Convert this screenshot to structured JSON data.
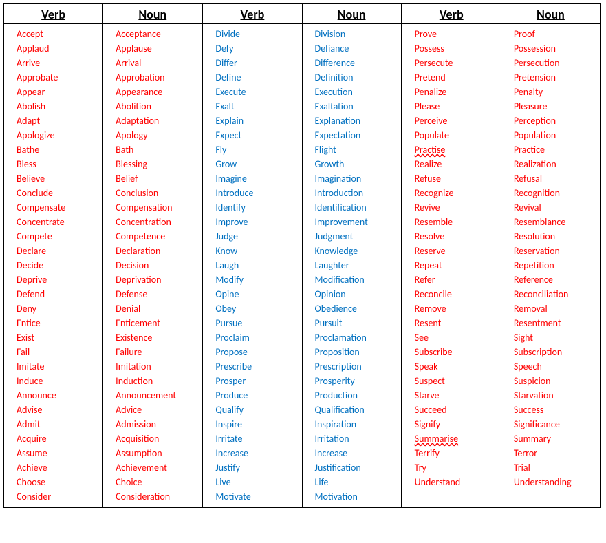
{
  "headers": {
    "verb": "Verb",
    "noun": "Noun"
  },
  "groups": [
    {
      "color": "c-red",
      "rows": [
        {
          "v": "Accept",
          "n": "Acceptance"
        },
        {
          "v": "Applaud",
          "n": "Applause"
        },
        {
          "v": "Arrive",
          "n": "Arrival"
        },
        {
          "v": "Approbate",
          "n": "Approbation"
        },
        {
          "v": "Appear",
          "n": "Appearance"
        },
        {
          "v": "Abolish",
          "n": "Abolition"
        },
        {
          "v": "Adapt",
          "n": "Adaptation"
        },
        {
          "v": "Apologize",
          "n": "Apology"
        },
        {
          "v": "Bathe",
          "n": "Bath"
        },
        {
          "v": "Bless",
          "n": "Blessing"
        },
        {
          "v": "Believe",
          "n": "Belief"
        },
        {
          "v": "Conclude",
          "n": "Conclusion"
        },
        {
          "v": "Compensate",
          "n": "Compensation"
        },
        {
          "v": "Concentrate",
          "n": "Concentration"
        },
        {
          "v": "Compete",
          "n": "Competence"
        },
        {
          "v": "Declare",
          "n": "Declaration"
        },
        {
          "v": "Decide",
          "n": "Decision"
        },
        {
          "v": "Deprive",
          "n": "Deprivation"
        },
        {
          "v": "Defend",
          "n": "Defense"
        },
        {
          "v": "Deny",
          "n": "Denial"
        },
        {
          "v": "Entice",
          "n": "Enticement"
        },
        {
          "v": "Exist",
          "n": "Existence"
        },
        {
          "v": "Fail",
          "n": "Failure"
        },
        {
          "v": "Imitate",
          "n": "Imitation"
        },
        {
          "v": "Induce",
          "n": "Induction"
        },
        {
          "v": "Announce",
          "n": "Announcement"
        },
        {
          "v": "Advise",
          "n": "Advice"
        },
        {
          "v": "Admit",
          "n": "Admission"
        },
        {
          "v": "Acquire",
          "n": "Acquisition"
        },
        {
          "v": "Assume",
          "n": "Assumption"
        },
        {
          "v": "Achieve",
          "n": "Achievement"
        },
        {
          "v": "Choose",
          "n": "Choice"
        },
        {
          "v": "Consider",
          "n": "Consideration"
        }
      ]
    },
    {
      "color": "c-blue",
      "rows": [
        {
          "v": "Divide",
          "n": "Division"
        },
        {
          "v": "Defy",
          "n": "Defiance"
        },
        {
          "v": "Differ",
          "n": "Difference"
        },
        {
          "v": "Define",
          "n": "Definition"
        },
        {
          "v": "Execute",
          "n": "Execution"
        },
        {
          "v": "Exalt",
          "n": "Exaltation"
        },
        {
          "v": "Explain",
          "n": "Explanation"
        },
        {
          "v": "Expect",
          "n": "Expectation"
        },
        {
          "v": "Fly",
          "n": "Flight"
        },
        {
          "v": "Grow",
          "n": "Growth"
        },
        {
          "v": "Imagine",
          "n": "Imagination"
        },
        {
          "v": "Introduce",
          "n": "Introduction"
        },
        {
          "v": "Identify",
          "n": "Identification"
        },
        {
          "v": "Improve",
          "n": "Improvement"
        },
        {
          "v": "Judge",
          "n": "Judgment"
        },
        {
          "v": "Know",
          "n": "Knowledge"
        },
        {
          "v": "Laugh",
          "n": "Laughter"
        },
        {
          "v": "Modify",
          "n": "Modification"
        },
        {
          "v": "Opine",
          "n": "Opinion"
        },
        {
          "v": "Obey",
          "n": "Obedience"
        },
        {
          "v": "Pursue",
          "n": "Pursuit"
        },
        {
          "v": "Proclaim",
          "n": "Proclamation"
        },
        {
          "v": "Propose",
          "n": "Proposition"
        },
        {
          "v": "Prescribe",
          "n": "Prescription"
        },
        {
          "v": "Prosper",
          "n": "Prosperity"
        },
        {
          "v": "Produce",
          "n": "Production"
        },
        {
          "v": "Qualify",
          "n": "Qualification"
        },
        {
          "v": "Inspire",
          "n": "Inspiration"
        },
        {
          "v": "Irritate",
          "n": "Irritation"
        },
        {
          "v": "Increase",
          "n": "Increase"
        },
        {
          "v": "Justify",
          "n": "Justification"
        },
        {
          "v": "Live",
          "n": "Life"
        },
        {
          "v": "Motivate",
          "n": "Motivation"
        }
      ]
    },
    {
      "color": "c-red",
      "rows": [
        {
          "v": "Prove",
          "n": "Proof"
        },
        {
          "v": "Possess",
          "n": "Possession"
        },
        {
          "v": "Persecute",
          "n": "Persecution"
        },
        {
          "v": "Pretend",
          "n": "Pretension"
        },
        {
          "v": "Penalize",
          "n": "Penalty"
        },
        {
          "v": "Please",
          "n": "Pleasure"
        },
        {
          "v": "Perceive",
          "n": "Perception"
        },
        {
          "v": "Populate",
          "n": "Population"
        },
        {
          "v": "Practise",
          "vSquiggle": true,
          "n": "Practice"
        },
        {
          "v": "Realize",
          "n": "Realization"
        },
        {
          "v": "Refuse",
          "n": "Refusal"
        },
        {
          "v": "Recognize",
          "n": "Recognition"
        },
        {
          "v": "Revive",
          "n": "Revival"
        },
        {
          "v": "Resemble",
          "n": "Resemblance"
        },
        {
          "v": "Resolve",
          "n": "Resolution"
        },
        {
          "v": "Reserve",
          "n": "Reservation"
        },
        {
          "v": "Repeat",
          "n": "Repetition"
        },
        {
          "v": "Refer",
          "n": "Reference"
        },
        {
          "v": "Reconcile",
          "n": "Reconciliation"
        },
        {
          "v": "Remove",
          "n": "Removal"
        },
        {
          "v": "Resent",
          "n": "Resentment"
        },
        {
          "v": "See",
          "n": "Sight"
        },
        {
          "v": "Subscribe",
          "n": "Subscription"
        },
        {
          "v": "Speak",
          "n": "Speech"
        },
        {
          "v": "Suspect",
          "n": "Suspicion"
        },
        {
          "v": "Starve",
          "n": "Starvation"
        },
        {
          "v": "Succeed",
          "n": "Success"
        },
        {
          "v": "Signify",
          "n": "Significance"
        },
        {
          "v": "Summarise",
          "vSquiggle": true,
          "n": "Summary"
        },
        {
          "v": "Terrify",
          "n": "Terror"
        },
        {
          "v": "Try",
          "n": "Trial"
        },
        {
          "v": "Understand",
          "n": "Understanding"
        }
      ]
    }
  ]
}
